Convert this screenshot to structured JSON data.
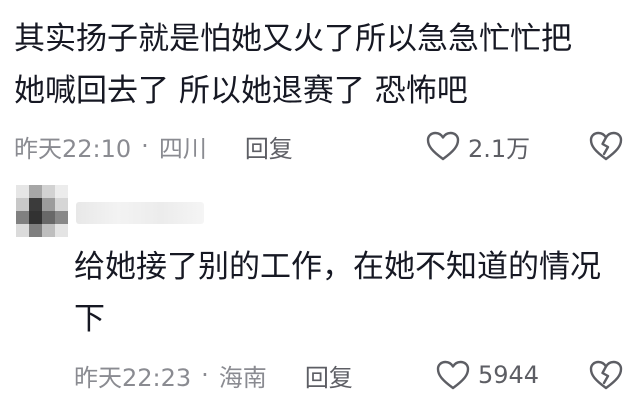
{
  "comments": [
    {
      "text_lines": [
        "其实扬子就是怕她又火了所以急急忙忙把",
        "她喊回去了 所以她退赛了 恐怖吧"
      ],
      "time": "昨天22:10",
      "separator": "·",
      "location": "四川",
      "reply_label": "回复",
      "likes": "2.1万"
    },
    {
      "text_lines": [
        "给她接了别的工作，在她不知道的情况",
        "下"
      ],
      "time": "昨天22:23",
      "separator": "·",
      "location": "海南",
      "reply_label": "回复",
      "likes": "5944"
    }
  ],
  "icons": {
    "like": "heart-outline-icon",
    "dislike": "broken-heart-icon"
  },
  "colors": {
    "text": "#161823",
    "meta": "#8a8b91",
    "action": "#5d5e64"
  }
}
